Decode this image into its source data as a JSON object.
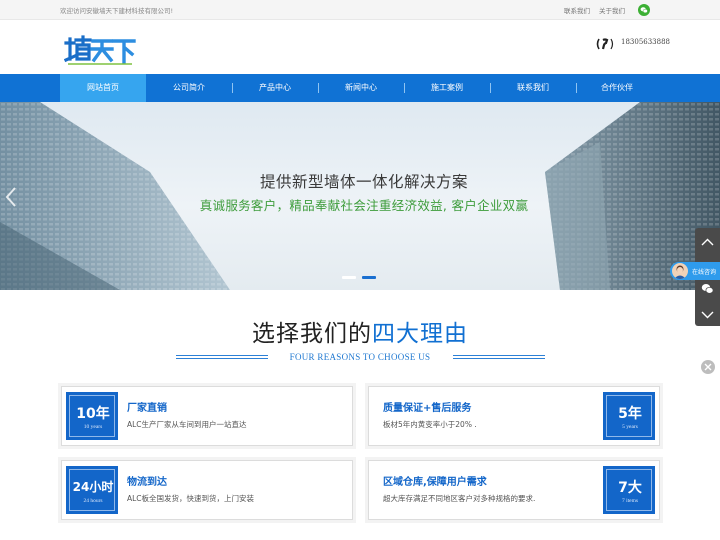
{
  "topbar": {
    "welcome": "欢迎访问安徽墙天下建材科技有限公司!",
    "links": [
      "联系我们",
      "关于我们"
    ]
  },
  "header": {
    "logo_text": "墙天下",
    "phone": "18305633888"
  },
  "nav": {
    "items": [
      "网站首页",
      "公司简介",
      "产品中心",
      "新闻中心",
      "施工案例",
      "联系我们",
      "合作伙伴"
    ],
    "active_index": 0
  },
  "banner": {
    "title": "提供新型墙体一体化解决方案",
    "subtitle": "真诚服务客户，精品奉献社会注重经济效益, 客户企业双赢",
    "slide_count": 2,
    "active_slide": 1
  },
  "side_tools": {
    "consult_label": "在线咨询"
  },
  "reasons": {
    "title_part1": "选择我们的",
    "title_part2": "四大理由",
    "subtitle": "FOUR REASONS TO CHOOSE US",
    "cards": [
      {
        "badge_big": "10年",
        "badge_small": "10 years",
        "title": "厂家直销",
        "desc": "ALC生产厂家从车间到用户一站直达"
      },
      {
        "badge_big": "5年",
        "badge_small": "5 years",
        "title": "质量保证+售后服务",
        "desc": "板材5年内黄变率小于20% ."
      },
      {
        "badge_big": "24小时",
        "badge_small": "24 hours",
        "title": "物流到达",
        "desc": "ALC板全国发货，快速到货，上门安装"
      },
      {
        "badge_big": "7大",
        "badge_small": "7 items",
        "title": "区域仓库,保障用户需求",
        "desc": "超大库存满足不同地区客户对多种规格的要求."
      }
    ]
  },
  "colors": {
    "nav_blue": "#1072d4",
    "nav_active": "#36a5ef",
    "accent_blue": "#1366c9",
    "banner_green": "#3d9c3b"
  }
}
